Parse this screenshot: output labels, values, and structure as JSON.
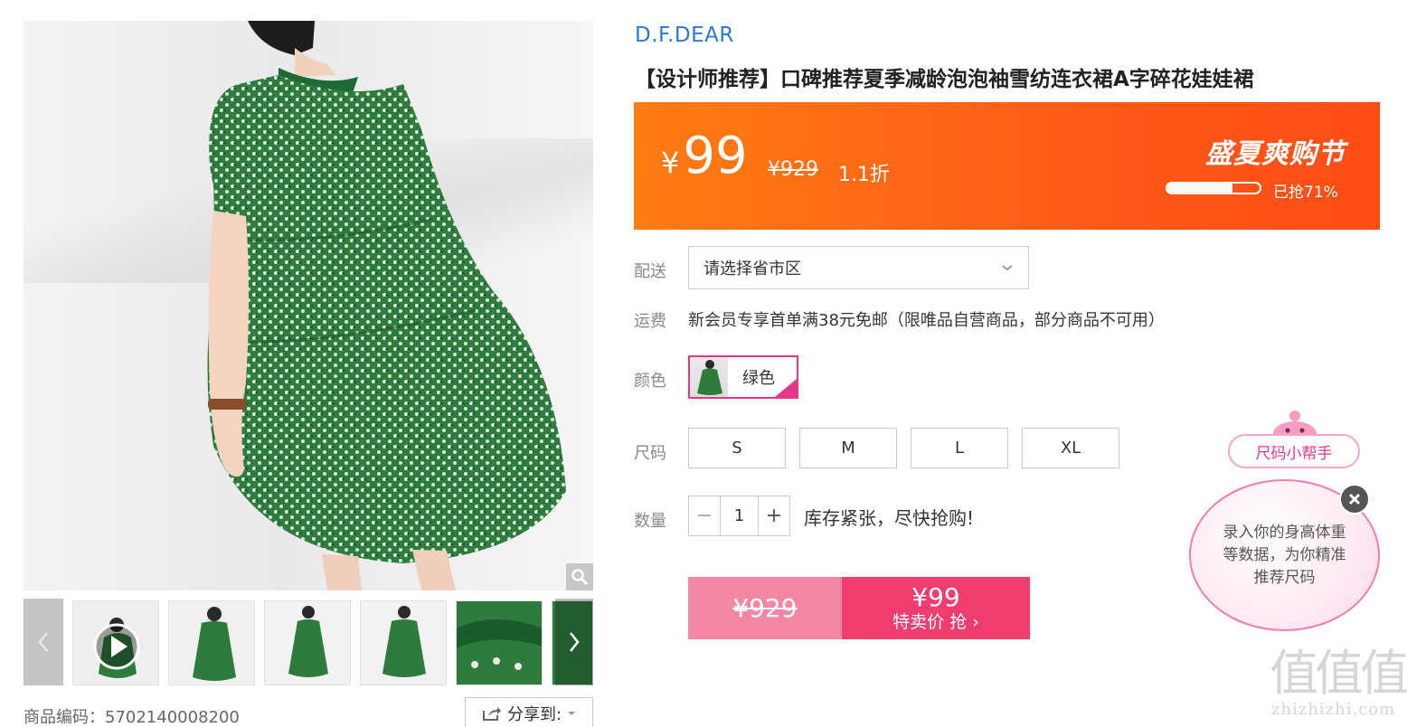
{
  "brand": "D.F.DEAR",
  "title": "【设计师推荐】口碑推荐夏季减龄泡泡袖雪纺连衣裙A字碎花娃娃裙",
  "price_bar": {
    "currency": "¥",
    "price": "99",
    "original_price": "¥929",
    "discount": "1.1折",
    "event": "盛夏爽购节",
    "sold_label": "已抢71%",
    "sold_fraction": 0.71,
    "color_start": "#ff7c12",
    "color_end": "#ff4d16"
  },
  "delivery": {
    "label": "配送",
    "placeholder": "请选择省市区"
  },
  "shipping": {
    "label": "运费",
    "text": "新会员专享首单满38元免邮（限唯品自营商品，部分商品不可用）"
  },
  "color": {
    "label": "颜色",
    "options": [
      {
        "name": "绿色",
        "selected": true
      }
    ]
  },
  "size": {
    "label": "尺码",
    "options": [
      "S",
      "M",
      "L",
      "XL"
    ]
  },
  "quantity": {
    "label": "数量",
    "value": "1",
    "minus": "−",
    "plus": "+",
    "stock_note": "库存紧张，尽快抢购!"
  },
  "buy": {
    "original": "¥929",
    "price": "¥99",
    "cta": "特卖价 抢 ›"
  },
  "product_code": "商品编码：5702140008200",
  "share_label": "分享到:",
  "helper": {
    "tag": "尺码小帮手",
    "text": "录入你的身高体重等数据，为你精准推荐尺码"
  },
  "watermark": {
    "big": "值值值",
    "small": "zhizhizhi.com"
  },
  "colors": {
    "accent_pink": "#ef3d70",
    "brand_blue": "#2979d6",
    "selected_border": "#e4378a"
  }
}
